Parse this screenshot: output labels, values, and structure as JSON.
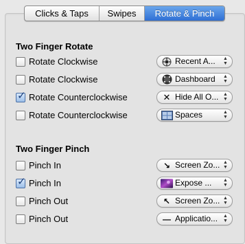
{
  "tabs": [
    "Clicks & Taps",
    "Swipes",
    "Rotate & Pinch"
  ],
  "active_tab": "Rotate & Pinch",
  "sections": {
    "rotate_title": "Two Finger Rotate",
    "pinch_title": "Two Finger Pinch"
  },
  "rotate_rows": [
    {
      "label": "Rotate Clockwise",
      "checked": false,
      "action": "Recent A...",
      "icon": "compass-icon"
    },
    {
      "label": "Rotate Clockwise",
      "checked": false,
      "action": "Dashboard",
      "icon": "dashboard-icon"
    },
    {
      "label": "Rotate Counterclockwise",
      "checked": true,
      "action": "Hide All O...",
      "icon": "close-x-icon"
    },
    {
      "label": "Rotate Counterclockwise",
      "checked": false,
      "action": "Spaces",
      "icon": "spaces-icon"
    }
  ],
  "pinch_rows": [
    {
      "label": "Pinch In",
      "checked": false,
      "action": "Screen Zo...",
      "icon": "zoom-in-arrows-icon"
    },
    {
      "label": "Pinch In",
      "checked": true,
      "action": "Expose ...",
      "icon": "expose-icon"
    },
    {
      "label": "Pinch Out",
      "checked": false,
      "action": "Screen Zo...",
      "icon": "zoom-out-arrows-icon"
    },
    {
      "label": "Pinch Out",
      "checked": false,
      "action": "Applicatio...",
      "icon": "dash-icon"
    }
  ],
  "glyphs": {
    "checkmark": "✓",
    "popup_up": "▲",
    "popup_down": "▼",
    "close_x": "✕",
    "dash": "—",
    "arrow_in": "↘",
    "arrow_out": "↖",
    "compass": "✪",
    "dashboard": "◉"
  }
}
